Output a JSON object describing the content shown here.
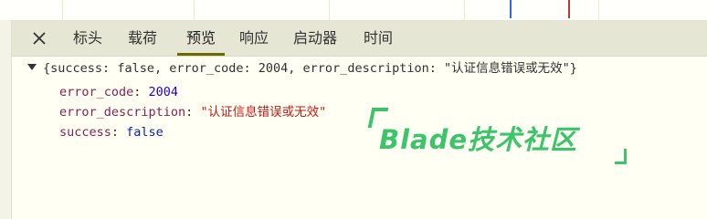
{
  "tabs": [
    {
      "label": "标头",
      "active": false
    },
    {
      "label": "载荷",
      "active": false
    },
    {
      "label": "预览",
      "active": true
    },
    {
      "label": "响应",
      "active": false
    },
    {
      "label": "启动器",
      "active": false
    },
    {
      "label": "时间",
      "active": false
    }
  ],
  "close_icon": "close-icon",
  "preview": {
    "summary": {
      "open": "{",
      "k1": "success",
      "v1": "false",
      "k2": "error_code",
      "v2": "2004",
      "k3": "error_description",
      "v3": "\"认证信息错误或无效\"",
      "close": "}"
    },
    "fields": [
      {
        "key": "error_code",
        "value": "2004",
        "type": "number"
      },
      {
        "key": "error_description",
        "value": "\"认证信息错误或无效\"",
        "type": "string"
      },
      {
        "key": "success",
        "value": "false",
        "type": "boolean"
      }
    ]
  },
  "watermark": {
    "text": "Blade技术社区"
  },
  "colors": {
    "accent": "#6b6b00",
    "watermark": "#3cc46a",
    "string": "#c41a16",
    "key": "#8a1f52",
    "number": "#1c00cf"
  }
}
